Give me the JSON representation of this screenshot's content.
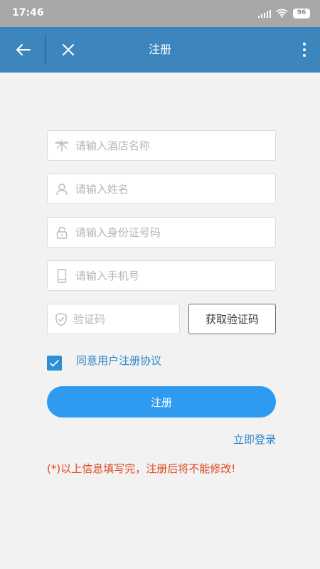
{
  "status_bar": {
    "time": "17:46",
    "battery": "96",
    "icons": [
      "signal-icon",
      "wifi-icon",
      "battery-icon"
    ]
  },
  "app_bar": {
    "title": "注册",
    "color": "#3d86bd",
    "icons": [
      "back-arrow-icon",
      "close-icon",
      "more-vertical-icon"
    ]
  },
  "form": {
    "hotel_name": {
      "placeholder": "请输入酒店名称",
      "value": "",
      "icon": "palm-tree-icon"
    },
    "name": {
      "placeholder": "请输入姓名",
      "value": "",
      "icon": "user-icon"
    },
    "id_number": {
      "placeholder": "请输入身份证号码",
      "value": "",
      "icon": "lock-icon"
    },
    "phone": {
      "placeholder": "请输入手机号",
      "value": "",
      "icon": "phone-icon"
    },
    "code": {
      "placeholder": "验证码",
      "value": "",
      "icon": "shield-check-icon"
    },
    "get_code_label": "获取验证码"
  },
  "agreement": {
    "checked": true,
    "label": "同意用户注册协议"
  },
  "register_label": "注册",
  "login_link": "立即登录",
  "notice": "(*)以上信息填写完，注册后将不能修改!",
  "colors": {
    "primary_button": "#2e9af0",
    "link": "#2e86c8",
    "notice": "#e0471e",
    "status_bar": "#a8a8a8",
    "background": "#f2f2f2"
  }
}
